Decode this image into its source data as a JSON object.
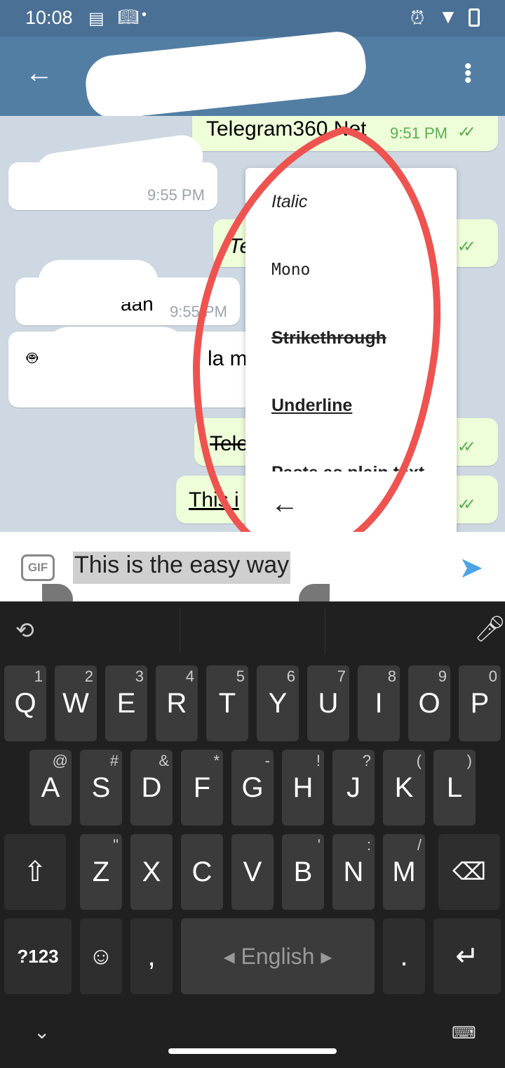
{
  "status_bar": {
    "time": "10:08",
    "icons": [
      "news-icon",
      "book-icon",
      "dot-icon",
      "alarm-icon",
      "wifi-icon",
      "battery-icon"
    ]
  },
  "app_bar": {
    "back_icon": "arrow-left-icon",
    "menu_icon": "more-vert-icon"
  },
  "messages": [
    {
      "dir": "out",
      "text": "Telegram360.Net",
      "time": "9:51 PM",
      "read": true
    },
    {
      "dir": "in",
      "text": "",
      "time": "9:55 PM"
    },
    {
      "dir": "out",
      "text": "Te",
      "time": "",
      "read": true,
      "style": "italic"
    },
    {
      "dir": "in",
      "text": "aan",
      "time": "9:55 PM"
    },
    {
      "dir": "in",
      "text": "la m",
      "time": ""
    },
    {
      "dir": "out",
      "text": "Tele",
      "time": "",
      "read": true,
      "style": "strikethrough"
    },
    {
      "dir": "out",
      "text": "This i",
      "time": "",
      "read": true,
      "style": "underline"
    }
  ],
  "format_menu": {
    "items": [
      "Italic",
      "Mono",
      "Strikethrough",
      "Underline",
      "Paste as plain text"
    ],
    "back_icon": "arrow-left-icon"
  },
  "composer": {
    "gif_label": "GIF",
    "value": "This is the easy way",
    "send_icon": "send-icon"
  },
  "keyboard": {
    "row1": [
      [
        "Q",
        "1"
      ],
      [
        "W",
        "2"
      ],
      [
        "E",
        "3"
      ],
      [
        "R",
        "4"
      ],
      [
        "T",
        "5"
      ],
      [
        "Y",
        "6"
      ],
      [
        "U",
        "7"
      ],
      [
        "I",
        "8"
      ],
      [
        "O",
        "9"
      ],
      [
        "P",
        "0"
      ]
    ],
    "row2": [
      [
        "A",
        "@"
      ],
      [
        "S",
        "#"
      ],
      [
        "D",
        "&"
      ],
      [
        "F",
        "*"
      ],
      [
        "G",
        "-"
      ],
      [
        "H",
        "!"
      ],
      [
        "J",
        "?"
      ],
      [
        "K",
        "("
      ],
      [
        "L",
        ")"
      ]
    ],
    "row3": [
      [
        "Z",
        "\""
      ],
      [
        "X",
        ""
      ],
      [
        "C",
        ""
      ],
      [
        "V",
        ""
      ],
      [
        "B",
        "'"
      ],
      [
        "N",
        ":"
      ],
      [
        "M",
        "/"
      ]
    ],
    "symbols_label": "?123",
    "comma": ",",
    "period": ".",
    "space_label": "English"
  },
  "colors": {
    "accent": "#527ea4",
    "annotation": "#ef5350",
    "out_bubble": "#eefed9"
  }
}
